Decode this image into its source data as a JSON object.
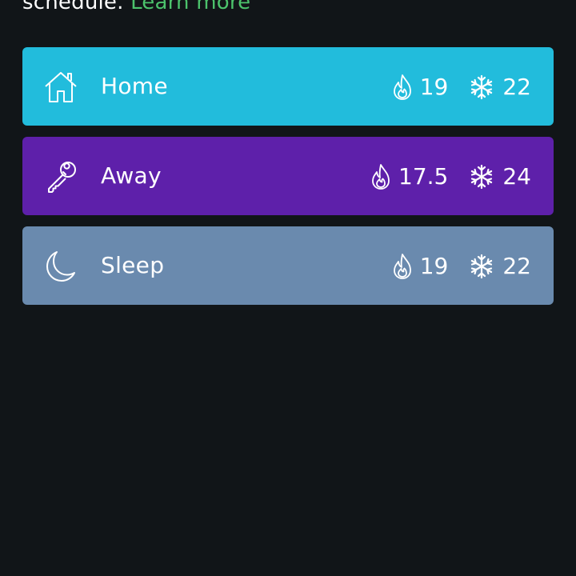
{
  "intro": {
    "text": "schedule.",
    "link": "Learn more"
  },
  "comfort_settings": [
    {
      "name": "Home",
      "icon": "house-icon",
      "heat": "19",
      "cool": "22",
      "color": "#22bcdc"
    },
    {
      "name": "Away",
      "icon": "key-icon",
      "heat": "17.5",
      "cool": "24",
      "color": "#5e20aa"
    },
    {
      "name": "Sleep",
      "icon": "moon-icon",
      "heat": "19",
      "cool": "22",
      "color": "#6a8aae"
    }
  ]
}
